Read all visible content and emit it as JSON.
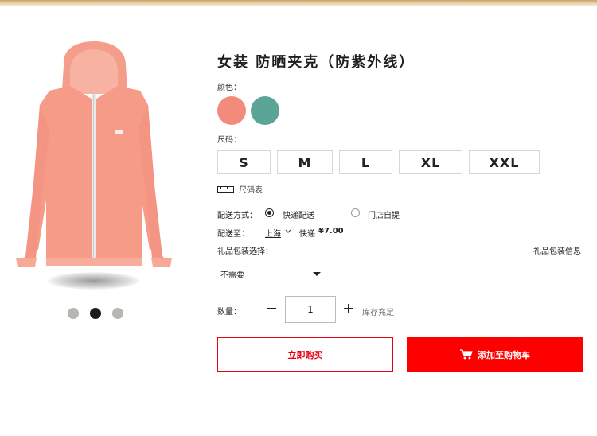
{
  "product": {
    "title": "女装 防晒夹克（防紫外线）",
    "image_name": "pink-hooded-jacket",
    "carousel_dots": 3,
    "active_dot": 1
  },
  "color": {
    "label": "颜色：",
    "options": [
      {
        "name": "coral-pink",
        "hex": "#f28b7b"
      },
      {
        "name": "teal",
        "hex": "#5aa595"
      }
    ]
  },
  "size": {
    "label": "尺码：",
    "options": [
      "S",
      "M",
      "L",
      "XL",
      "XXL"
    ],
    "chart_link": "尺码表",
    "chart_icon": "ruler-icon"
  },
  "delivery": {
    "method_label": "配送方式：",
    "option_express": "快递配送",
    "option_pickup": "门店自提",
    "selected": "快递配送",
    "to_label": "配送至：",
    "city": "上海",
    "carrier": "快递",
    "price": "¥7.00"
  },
  "gift": {
    "label": "礼品包装选择：",
    "info_link": "礼品包装信息",
    "selected": "不需要"
  },
  "quantity": {
    "label": "数量：",
    "value": "1",
    "stock": "库存充足"
  },
  "actions": {
    "buy_now": "立即购买",
    "add_to_cart": "添加至购物车"
  },
  "colors": {
    "accent_red": "#ff0000",
    "jacket": "#f39a87"
  }
}
